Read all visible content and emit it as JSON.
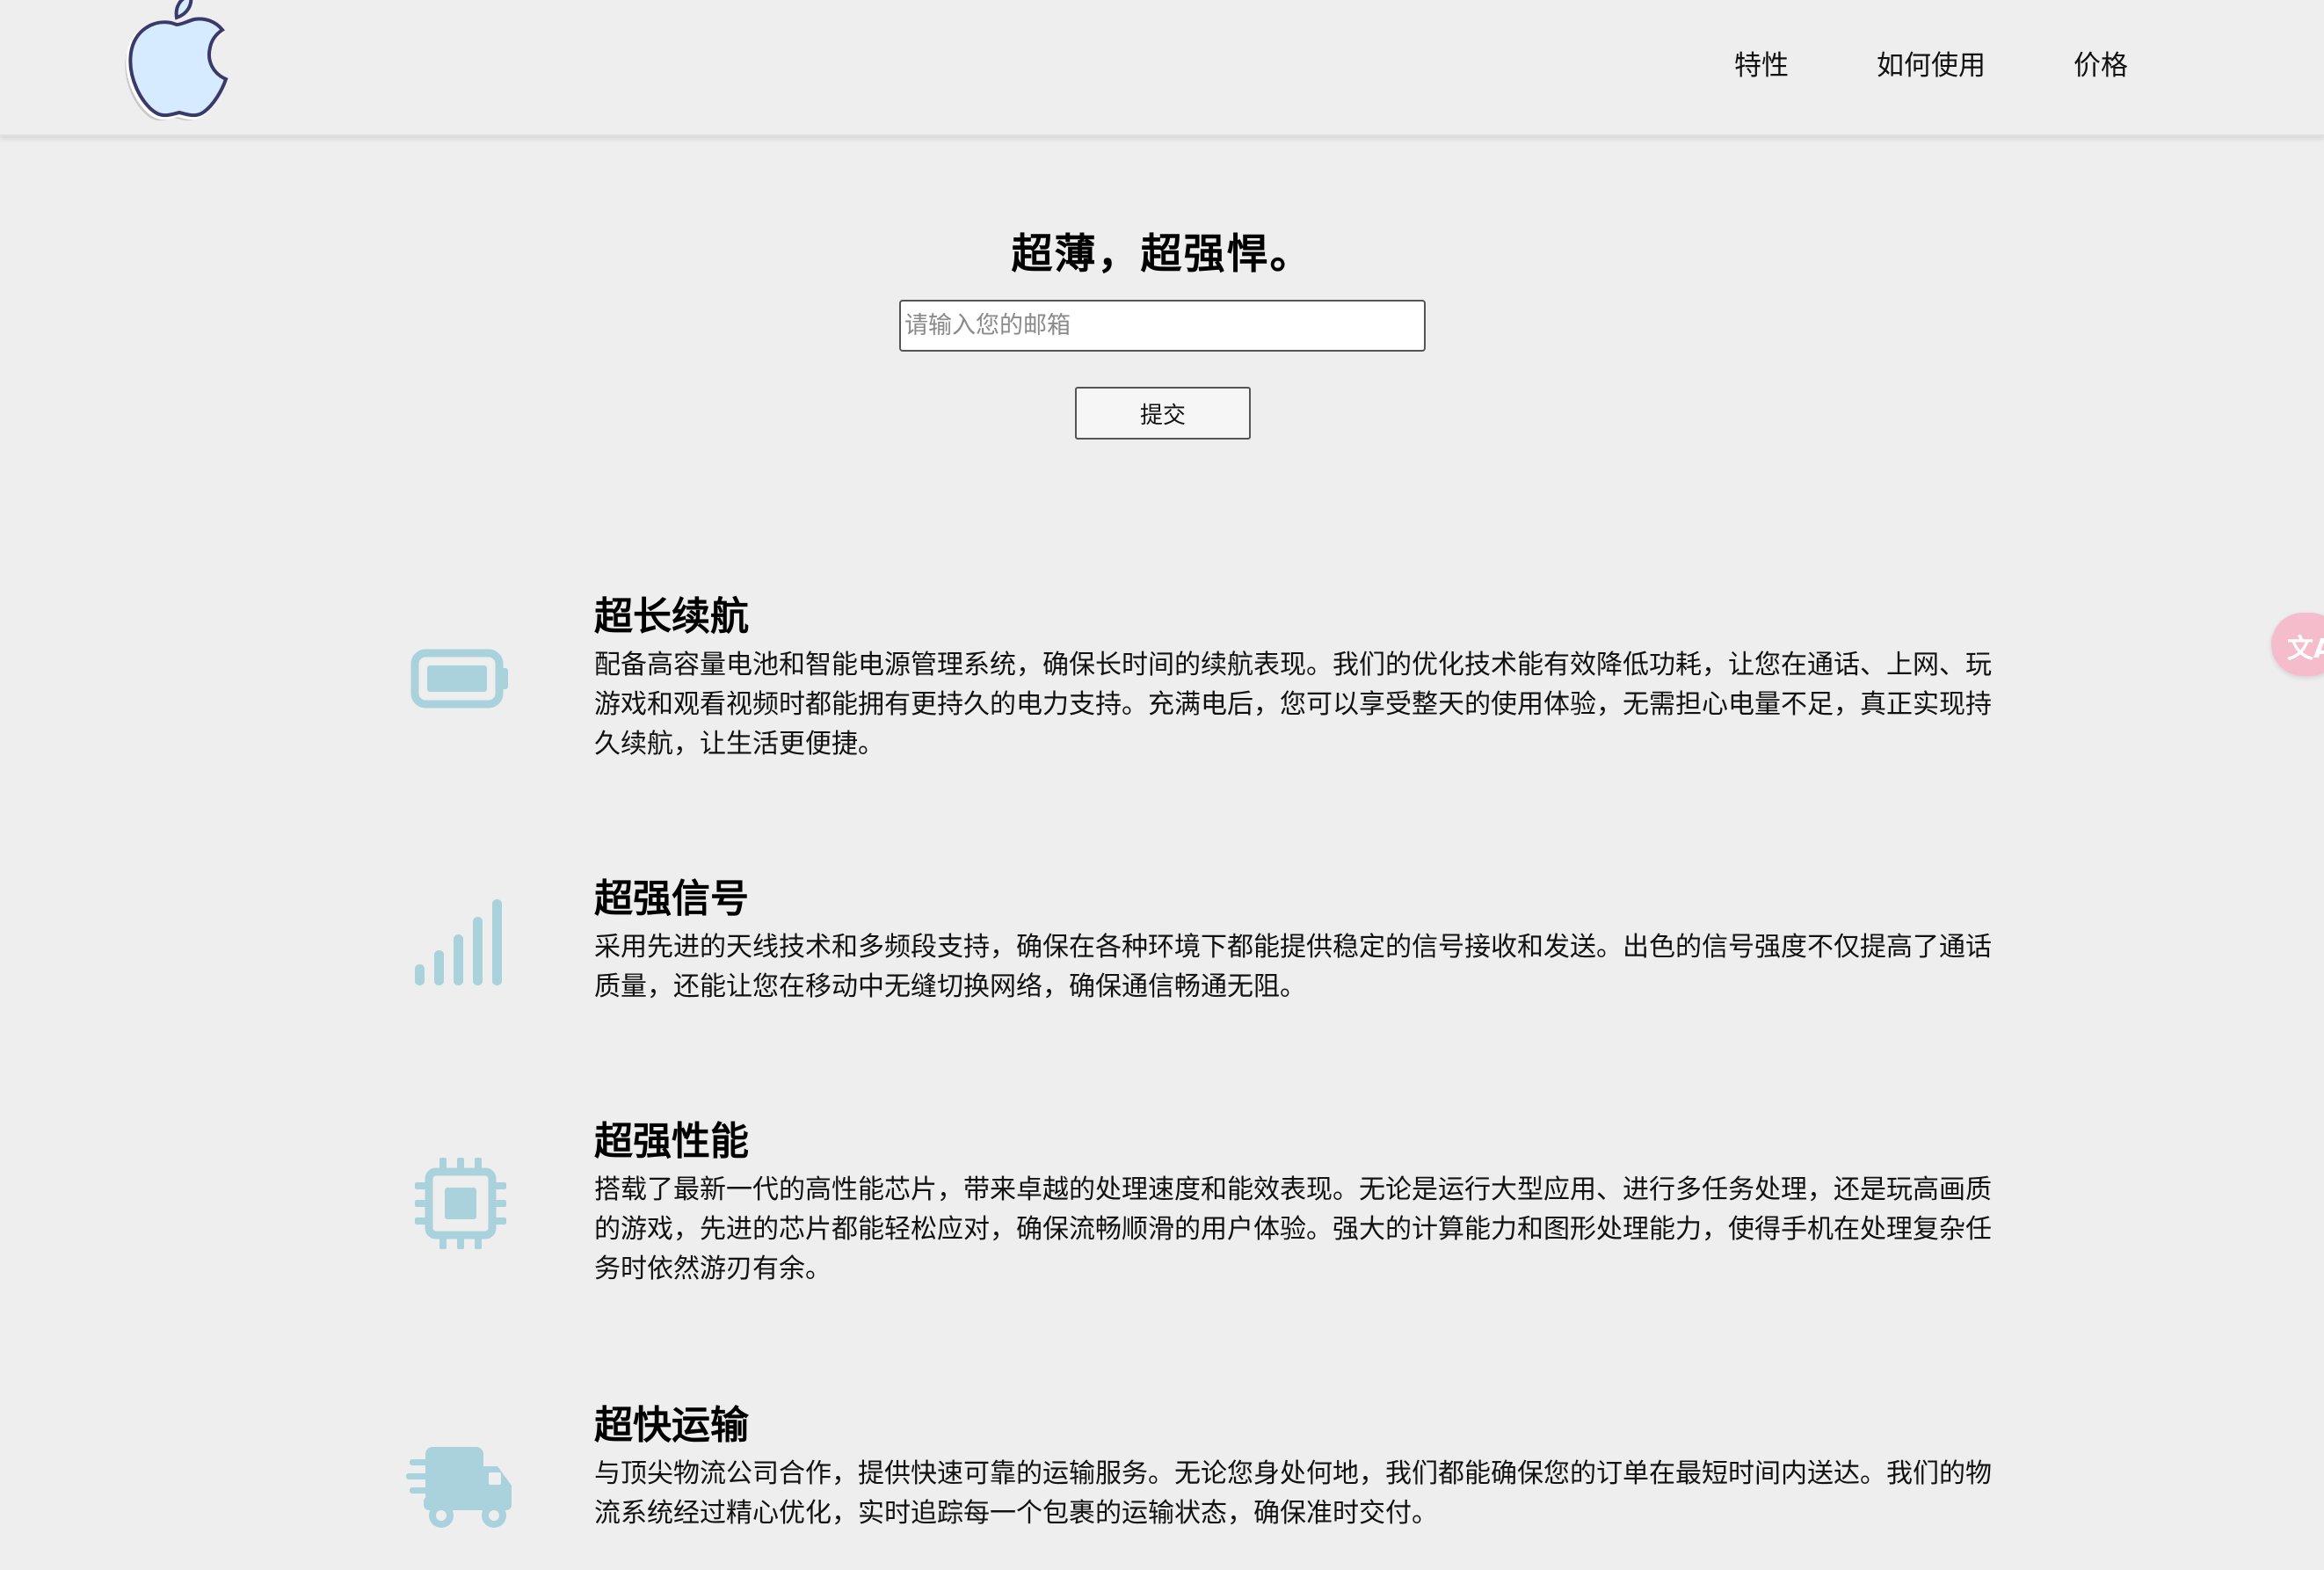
{
  "nav": {
    "items": [
      {
        "label": "特性"
      },
      {
        "label": "如何使用"
      },
      {
        "label": "价格"
      }
    ]
  },
  "hero": {
    "title": "超薄，超强悍。",
    "email_placeholder": "请输入您的邮箱",
    "email_value": "",
    "submit_label": "提交"
  },
  "features": [
    {
      "icon": "battery-icon",
      "title": "超长续航",
      "desc": "配备高容量电池和智能电源管理系统，确保长时间的续航表现。我们的优化技术能有效降低功耗，让您在通话、上网、玩游戏和观看视频时都能拥有更持久的电力支持。充满电后，您可以享受整天的使用体验，无需担心电量不足，真正实现持久续航，让生活更便捷。"
    },
    {
      "icon": "signal-icon",
      "title": "超强信号",
      "desc": "采用先进的天线技术和多频段支持，确保在各种环境下都能提供稳定的信号接收和发送。出色的信号强度不仅提高了通话质量，还能让您在移动中无缝切换网络，确保通信畅通无阻。"
    },
    {
      "icon": "chip-icon",
      "title": "超强性能",
      "desc": "搭载了最新一代的高性能芯片，带来卓越的处理速度和能效表现。无论是运行大型应用、进行多任务处理，还是玩高画质的游戏，先进的芯片都能轻松应对，确保流畅顺滑的用户体验。强大的计算能力和图形处理能力，使得手机在处理复杂任务时依然游刃有余。"
    },
    {
      "icon": "truck-icon",
      "title": "超快运输",
      "desc": "与顶尖物流公司合作，提供快速可靠的运输服务。无论您身处何地，我们都能确保您的订单在最短时间内送达。我们的物流系统经过精心优化，实时追踪每一个包裹的运输状态，确保准时交付。"
    }
  ],
  "colors": {
    "icon": "#a9d2dc",
    "background": "#eeeeee",
    "translate_fab": "#f5bccb"
  }
}
